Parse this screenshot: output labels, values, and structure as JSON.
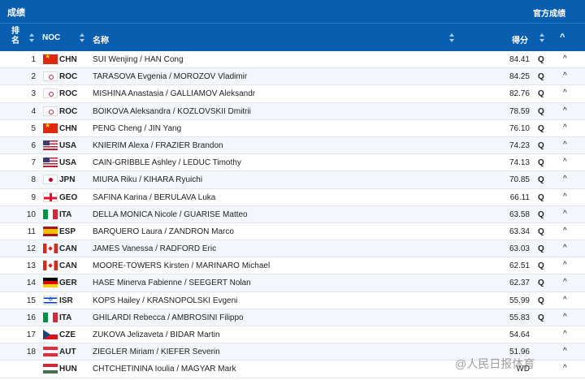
{
  "topbar": {
    "title": "成绩",
    "official": "官方成绩"
  },
  "header": {
    "rank": "排名",
    "noc": "NOC",
    "name": "名称",
    "score": "得分",
    "collapse": "^"
  },
  "rows": [
    {
      "rank": "1",
      "flag": "chn",
      "noc": "CHN",
      "name": "SUI Wenjing / HAN Cong",
      "score": "84.41",
      "q": "Q",
      "arrow": "^"
    },
    {
      "rank": "2",
      "flag": "roc",
      "noc": "ROC",
      "name": "TARASOVA Evgenia / MOROZOV Vladimir",
      "score": "84.25",
      "q": "Q",
      "arrow": "^"
    },
    {
      "rank": "3",
      "flag": "roc",
      "noc": "ROC",
      "name": "MISHINA Anastasia / GALLIAMOV Aleksandr",
      "score": "82.76",
      "q": "Q",
      "arrow": "^"
    },
    {
      "rank": "4",
      "flag": "roc",
      "noc": "ROC",
      "name": "BOIKOVA Aleksandra / KOZLOVSKII Dmitrii",
      "score": "78.59",
      "q": "Q",
      "arrow": "^"
    },
    {
      "rank": "5",
      "flag": "chn",
      "noc": "CHN",
      "name": "PENG Cheng / JIN Yang",
      "score": "76.10",
      "q": "Q",
      "arrow": "^"
    },
    {
      "rank": "6",
      "flag": "usa",
      "noc": "USA",
      "name": "KNIERIM Alexa / FRAZIER Brandon",
      "score": "74.23",
      "q": "Q",
      "arrow": "^"
    },
    {
      "rank": "7",
      "flag": "usa",
      "noc": "USA",
      "name": "CAIN-GRIBBLE Ashley / LEDUC Timothy",
      "score": "74.13",
      "q": "Q",
      "arrow": "^"
    },
    {
      "rank": "8",
      "flag": "jpn",
      "noc": "JPN",
      "name": "MIURA Riku / KIHARA Ryuichi",
      "score": "70.85",
      "q": "Q",
      "arrow": "^"
    },
    {
      "rank": "9",
      "flag": "geo",
      "noc": "GEO",
      "name": "SAFINA Karina / BERULAVA Luka",
      "score": "66.11",
      "q": "Q",
      "arrow": "^"
    },
    {
      "rank": "10",
      "flag": "ita",
      "noc": "ITA",
      "name": "DELLA MONICA Nicole / GUARISE Matteo",
      "score": "63.58",
      "q": "Q",
      "arrow": "^"
    },
    {
      "rank": "11",
      "flag": "esp",
      "noc": "ESP",
      "name": "BARQUERO Laura / ZANDRON Marco",
      "score": "63.34",
      "q": "Q",
      "arrow": "^"
    },
    {
      "rank": "12",
      "flag": "can",
      "noc": "CAN",
      "name": "JAMES Vanessa / RADFORD Eric",
      "score": "63.03",
      "q": "Q",
      "arrow": "^"
    },
    {
      "rank": "13",
      "flag": "can",
      "noc": "CAN",
      "name": "MOORE-TOWERS Kirsten / MARINARO Michael",
      "score": "62.51",
      "q": "Q",
      "arrow": "^"
    },
    {
      "rank": "14",
      "flag": "ger",
      "noc": "GER",
      "name": "HASE Minerva Fabienne / SEEGERT Nolan",
      "score": "62.37",
      "q": "Q",
      "arrow": "^"
    },
    {
      "rank": "15",
      "flag": "isr",
      "noc": "ISR",
      "name": "KOPS Hailey / KRASNOPOLSKI Evgeni",
      "score": "55.99",
      "q": "Q",
      "arrow": "^"
    },
    {
      "rank": "16",
      "flag": "ita",
      "noc": "ITA",
      "name": "GHILARDI Rebecca / AMBROSINI Filippo",
      "score": "55.83",
      "q": "Q",
      "arrow": "^"
    },
    {
      "rank": "17",
      "flag": "cze",
      "noc": "CZE",
      "name": "ZUKOVA Jelizaveta / BIDAR Martin",
      "score": "54.64",
      "q": "",
      "arrow": "^"
    },
    {
      "rank": "18",
      "flag": "aut",
      "noc": "AUT",
      "name": "ZIEGLER Miriam / KIEFER Severin",
      "score": "51.96",
      "q": "",
      "arrow": "^"
    },
    {
      "rank": "",
      "flag": "hun",
      "noc": "HUN",
      "name": "CHTCHETININA Ioulia / MAGYAR Mark",
      "score": "WD",
      "q": "",
      "arrow": "^"
    }
  ],
  "watermark": "@人民日报体育",
  "colors": {
    "header_bg": "#0a5eb0",
    "row_alt": "#f3f6fa"
  }
}
